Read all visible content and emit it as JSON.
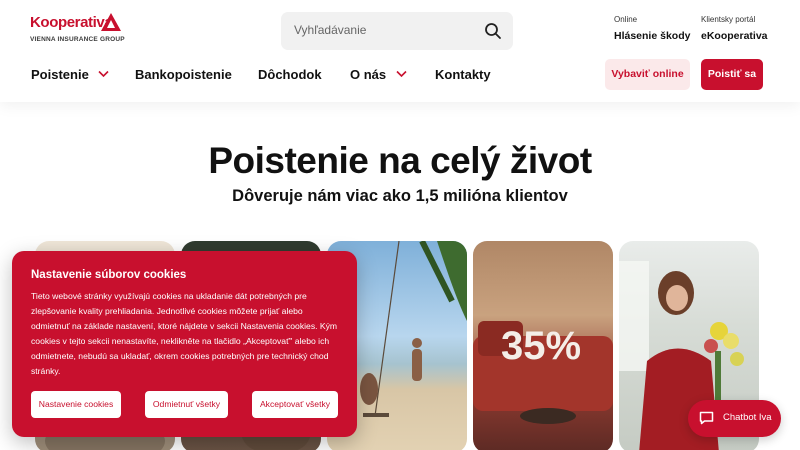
{
  "brand": {
    "name": "Kooperativa",
    "group": "VIENNA INSURANCE GROUP",
    "color": "#c8102e"
  },
  "search": {
    "placeholder": "Vyhľadávanie"
  },
  "quick_links": [
    {
      "small": "Online",
      "label": "Hlásenie škody"
    },
    {
      "small": "Klientsky portál",
      "label": "eKooperativa"
    }
  ],
  "nav": [
    {
      "label": "Poistenie",
      "dropdown": true
    },
    {
      "label": "Bankopoistenie",
      "dropdown": false
    },
    {
      "label": "Dôchodok",
      "dropdown": false
    },
    {
      "label": "O nás",
      "dropdown": true
    },
    {
      "label": "Kontakty",
      "dropdown": false
    }
  ],
  "actions": {
    "secondary": "Vybaviť online",
    "primary": "Poistiť sa"
  },
  "hero": {
    "title": "Poistenie na celý život",
    "subtitle": "Dôveruje nám viac ako 1,5 milióna klientov"
  },
  "cards": [
    {
      "image": "family-photo"
    },
    {
      "image": "people-outdoor-photo"
    },
    {
      "image": "beach-swing-photo"
    },
    {
      "image": "sofa-discount-photo",
      "badge": "35%"
    },
    {
      "image": "florist-woman-photo"
    }
  ],
  "cookie": {
    "title": "Nastavenie súborov cookies",
    "text": "Tieto webové stránky využívajú cookies na ukladanie dát potrebných pre zlepšovanie kvality prehliadania. Jednotlivé cookies môžete prijať alebo odmietnuť na základe nastavení, ktoré nájdete v sekcii Nastavenia cookies. Kým cookies v tejto sekcii nenastavíte, neklikněte na tlačidlo „Akceptovať\" alebo ich odmietnete, nebudú sa ukladať, okrem cookies potrebných pre technický chod stránky.",
    "buttons": {
      "settings": "Nastavenie cookies",
      "reject": "Odmietnuť všetky",
      "accept": "Akceptovať všetky"
    }
  },
  "chatbot": {
    "label": "Chatbot Iva"
  }
}
